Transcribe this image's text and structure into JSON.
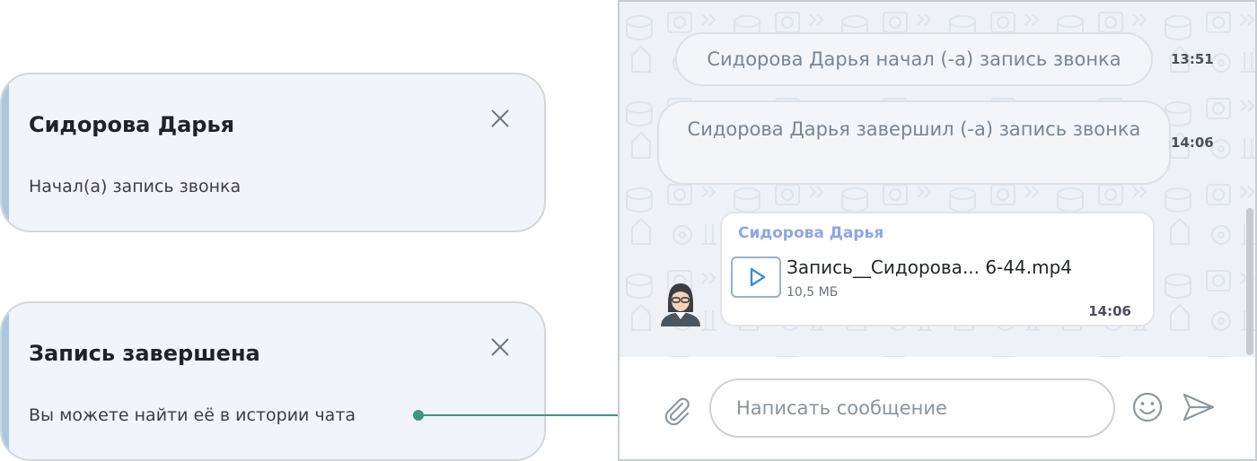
{
  "notifications": [
    {
      "title": "Сидорова Дарья",
      "body": "Начал(а) запись звонка",
      "close_icon": "close-icon"
    },
    {
      "title": "Запись завершена",
      "body": "Вы можете найти её в истории чата",
      "close_icon": "close-icon"
    }
  ],
  "chat": {
    "system_messages": [
      {
        "text": "Сидорова Дарья начал (-а) запись звонка",
        "time": "13:51"
      },
      {
        "text": "Сидорова Дарья завершил (-а) запись звонка",
        "time": "14:06"
      }
    ],
    "file_message": {
      "sender": "Сидорова Дарья",
      "file_name": "Запись__Сидорова... 6-44.mp4",
      "file_size": "10,5 МБ",
      "time": "14:06",
      "icon": "play-icon"
    },
    "composer": {
      "placeholder": "Написать сообщение",
      "value": "",
      "attach_icon": "paperclip-icon",
      "emoji_icon": "smiley-icon",
      "send_icon": "send-icon"
    }
  },
  "colors": {
    "accent_stripe": "#a9c8df",
    "connector": "#3e9582",
    "sender_name": "#8ea6e6",
    "chat_background": "#eef1f5"
  }
}
